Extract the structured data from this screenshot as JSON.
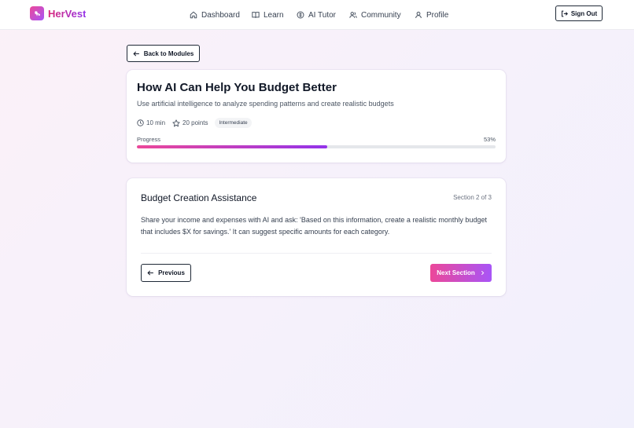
{
  "app": {
    "brand": "HerVest",
    "brand_gradient": [
      "#db2777",
      "#9333ea"
    ]
  },
  "nav": {
    "items": [
      {
        "label": "Dashboard",
        "icon": "home-icon"
      },
      {
        "label": "Learn",
        "icon": "book-icon"
      },
      {
        "label": "AI Tutor",
        "icon": "ai-icon"
      },
      {
        "label": "Community",
        "icon": "users-icon"
      },
      {
        "label": "Profile",
        "icon": "user-icon"
      }
    ],
    "sign_out": "Sign Out"
  },
  "back_button": "Back to Modules",
  "module": {
    "title": "How AI Can Help You Budget Better",
    "subtitle": "Use artificial intelligence to analyze spending patterns and create realistic budgets",
    "duration": "10 min",
    "points": "20 points",
    "level": "Intermediate",
    "progress_label": "Progress",
    "progress_text": "53%",
    "progress_value": 53
  },
  "section": {
    "title": "Budget Creation Assistance",
    "count": "Section 2 of 3",
    "body": "Share your income and expenses with AI and ask: 'Based on this information, create a realistic monthly budget that includes $X for savings.' It can suggest specific amounts for each category.",
    "previous": "Previous",
    "next": "Next Section"
  },
  "colors": {
    "accent_pink": "#ec4899",
    "accent_purple": "#9333ea"
  }
}
